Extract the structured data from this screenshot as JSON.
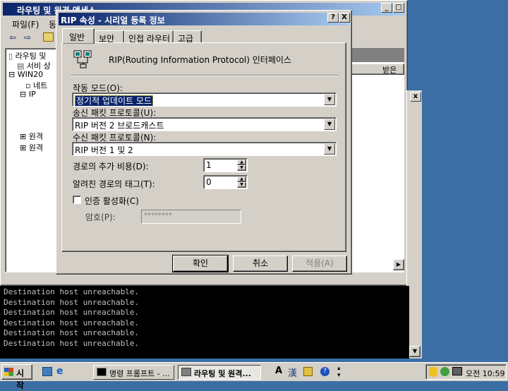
{
  "bg_window": {
    "title": "라우팅 및 원격 액세스",
    "menu": [
      "파일(F)",
      "동"
    ],
    "tree": [
      "라우팅 및",
      "서비 상",
      "WIN20",
      "네트",
      "IP",
      "원격",
      "원격"
    ],
    "column_header": "받은"
  },
  "console_lines": [
    "Destination host unreachable.",
    "Destination host unreachable.",
    "Destination host unreachable.",
    "Destination host unreachable.",
    "Destination host unreachable.",
    "Destination host unreachable."
  ],
  "dialog": {
    "title": "RIP 속성 - 시리얼 등록 정보",
    "help_btn": "?",
    "close_btn": "X",
    "tabs": [
      "일반",
      "보안",
      "인접 라우터",
      "고급"
    ],
    "heading": "RIP(Routing Information Protocol) 인터페이스",
    "mode_label": "작동 모드(O):",
    "mode_value": "정기적 업데이트 모드",
    "send_label": "송신 패킷 프로토콜(U):",
    "send_value": "RIP 버전 2 브로드캐스트",
    "recv_label": "수신 패킷 프로토콜(N):",
    "recv_value": "RIP 버전 1 및 2",
    "cost_label": "경로의 추가 비용(D):",
    "cost_value": "1",
    "tag_label": "알려진 경로의 태그(T):",
    "tag_value": "0",
    "auth_label": "인증 활성화(C)",
    "auth_checked": false,
    "password_label": "암호(P):",
    "password_value": "********",
    "ok": "확인",
    "cancel": "취소",
    "apply": "적용(A)"
  },
  "taskbar": {
    "start": "시작",
    "tasks": [
      "명령 프롬프트 - ...",
      "라우팅 및 원격..."
    ],
    "ime": [
      "A",
      "漢"
    ],
    "clock": "오전 10:59"
  },
  "colors": {
    "desktop": "#3a6ea5",
    "title_active": "#0a246a",
    "face": "#d4d0c8"
  }
}
